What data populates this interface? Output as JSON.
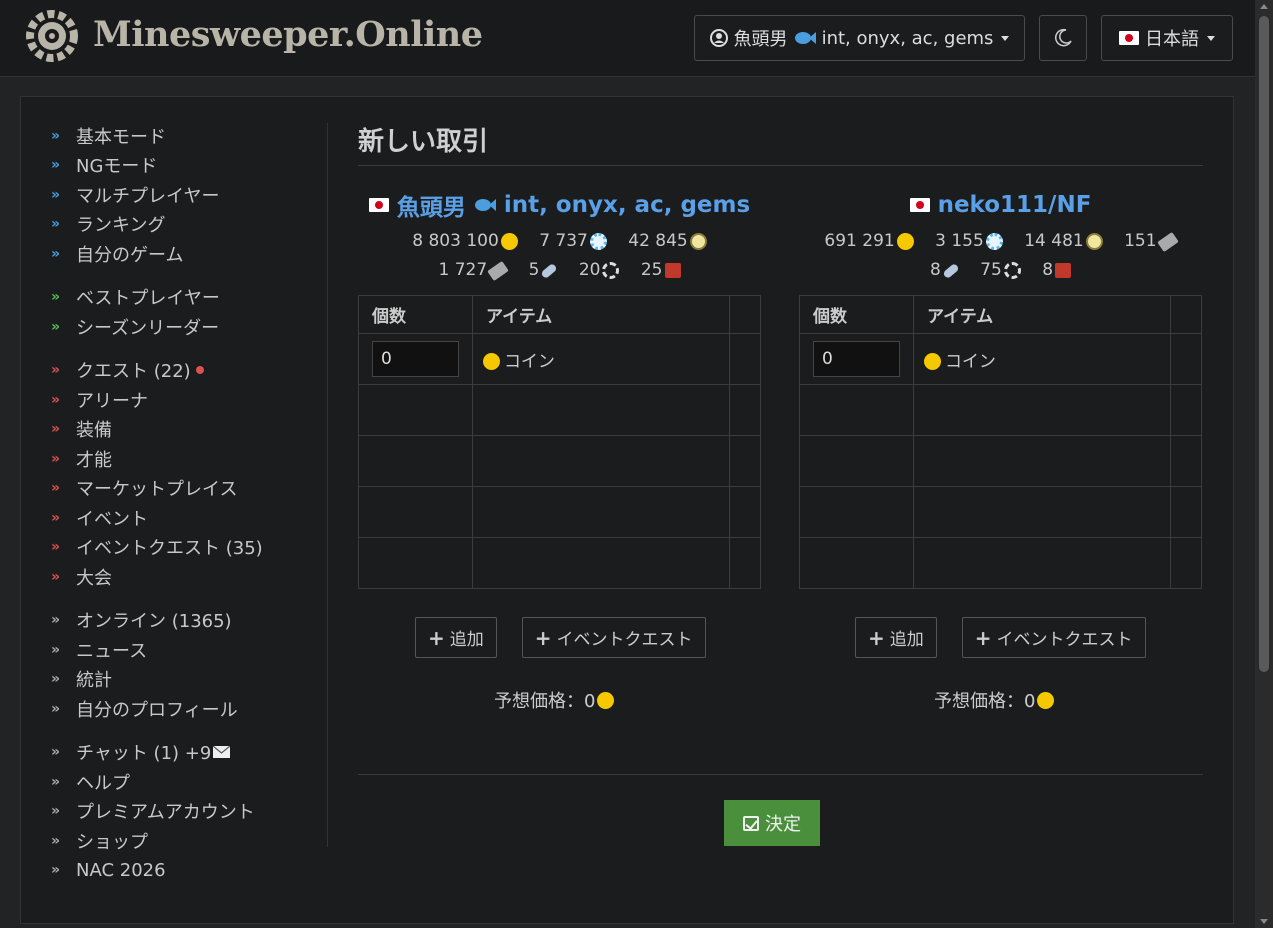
{
  "app": {
    "title": "Minesweeper.Online"
  },
  "header": {
    "user_label": "魚頭男",
    "user_tags": "int, onyx, ac, gems",
    "language": "日本語"
  },
  "sidebar": {
    "groups": [
      {
        "color": "blue",
        "items": [
          {
            "label": "基本モード"
          },
          {
            "label": "NGモード"
          },
          {
            "label": "マルチプレイヤー"
          },
          {
            "label": "ランキング"
          },
          {
            "label": "自分のゲーム"
          }
        ]
      },
      {
        "color": "green",
        "items": [
          {
            "label": "ベストプレイヤー"
          },
          {
            "label": "シーズンリーダー"
          }
        ]
      },
      {
        "color": "red",
        "items": [
          {
            "label": "クエスト (22)"
          },
          {
            "label": "アリーナ"
          },
          {
            "label": "装備"
          },
          {
            "label": "才能"
          },
          {
            "label": "マーケットプレイス"
          },
          {
            "label": "イベント"
          },
          {
            "label": "イベントクエスト (35)"
          },
          {
            "label": "大会"
          }
        ]
      },
      {
        "color": "gray",
        "items": [
          {
            "label": "オンライン (1365)"
          },
          {
            "label": "ニュース"
          },
          {
            "label": "統計"
          },
          {
            "label": "自分のプロフィール"
          }
        ]
      },
      {
        "color": "gray",
        "items": [
          {
            "label": "チャット (1) +9"
          },
          {
            "label": "ヘルプ"
          },
          {
            "label": "プレミアムアカウント"
          },
          {
            "label": "ショップ"
          },
          {
            "label": "NAC 2026"
          }
        ]
      }
    ]
  },
  "page": {
    "title": "新しい取引",
    "left": {
      "user": "魚頭男",
      "tags": "int, onyx, ac, gems",
      "stats_row1": [
        "8 803 100",
        "7 737",
        "42 845"
      ],
      "stats_row2": [
        "1 727",
        "5",
        "20",
        "25"
      ]
    },
    "right": {
      "user": "neko111/NF",
      "stats_row1": [
        "691 291",
        "3 155",
        "14 481",
        "151"
      ],
      "stats_row2": [
        "8",
        "75",
        "8"
      ]
    },
    "table": {
      "col_qty": "個数",
      "col_item": "アイテム",
      "qty_value": "0",
      "item_name": "コイン"
    },
    "buttons": {
      "add": "追加",
      "event_quest": "イベントクエスト"
    },
    "price_label": "予想価格：0",
    "submit": "決定"
  },
  "colors": {
    "link": "#5aa0e6",
    "submit": "#4a8f3c",
    "coin": "#f6c800"
  }
}
